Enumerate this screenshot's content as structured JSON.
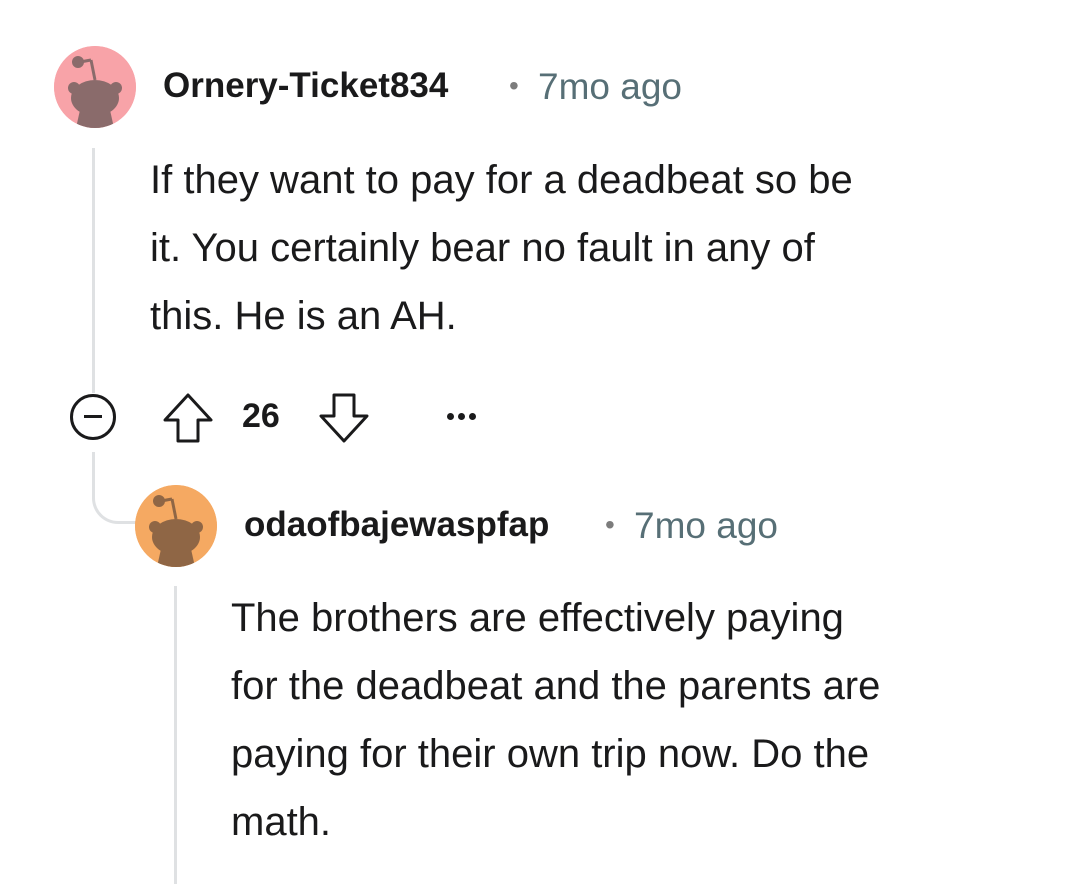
{
  "comments": [
    {
      "username": "Ornery-Ticket834",
      "separator": "•",
      "timestamp": "7mo ago",
      "body_lines": [
        "If they want to pay for a deadbeat so be",
        "it. You certainly bear no fault in any of",
        "this. He is an AH."
      ],
      "avatar_color": "#f8a3a8",
      "avatar_icon": "snoo-avatar-icon"
    },
    {
      "username": "odaofbajewaspfap",
      "separator": "•",
      "timestamp": "7mo ago",
      "body_lines": [
        "The brothers are effectively paying",
        "for the deadbeat and the parents are",
        "paying for their own trip now. Do the",
        "math."
      ],
      "avatar_color": "#f5a962",
      "avatar_icon": "snoo-avatar-icon"
    }
  ],
  "actions": {
    "vote_count": "26",
    "collapse_icon": "minus-circle-icon",
    "upvote_icon": "arrow-up-icon",
    "downvote_icon": "arrow-down-icon",
    "more_icon": "ellipsis-icon"
  },
  "colors": {
    "thread_line": "#dfe1e3",
    "text": "#1a1a1b",
    "meta": "#576f76"
  }
}
